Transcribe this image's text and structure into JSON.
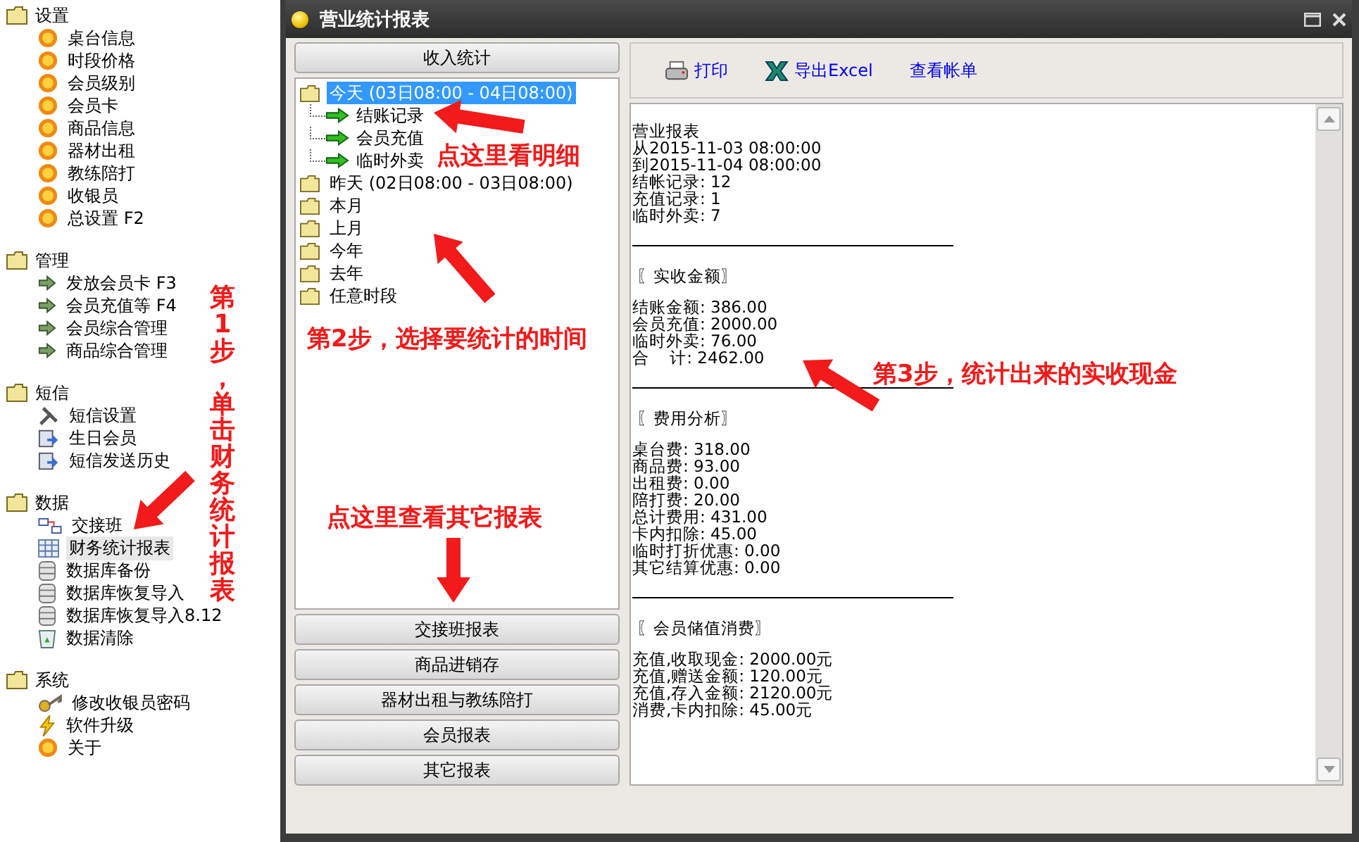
{
  "sidebar": {
    "groups": [
      {
        "label": "设置",
        "items": [
          {
            "label": "桌台信息",
            "kind": "sun",
            "selected": false
          },
          {
            "label": "时段价格",
            "kind": "sun",
            "selected": false
          },
          {
            "label": "会员级别",
            "kind": "sun",
            "selected": false
          },
          {
            "label": "会员卡",
            "kind": "sun",
            "selected": false
          },
          {
            "label": "商品信息",
            "kind": "sun",
            "selected": false
          },
          {
            "label": "器材出租",
            "kind": "sun",
            "selected": false
          },
          {
            "label": "教练陪打",
            "kind": "sun",
            "selected": false
          },
          {
            "label": "收银员",
            "kind": "sun",
            "selected": false
          },
          {
            "label": "总设置 F2",
            "kind": "sun",
            "selected": false
          }
        ]
      },
      {
        "label": "管理",
        "items": [
          {
            "label": "发放会员卡 F3",
            "kind": "arrow",
            "selected": false
          },
          {
            "label": "会员充值等 F4",
            "kind": "arrow",
            "selected": false
          },
          {
            "label": "会员综合管理",
            "kind": "arrow",
            "selected": false
          },
          {
            "label": "商品综合管理",
            "kind": "arrow",
            "selected": false
          }
        ]
      },
      {
        "label": "短信",
        "items": [
          {
            "label": "短信设置",
            "kind": "tools",
            "selected": false
          },
          {
            "label": "生日会员",
            "kind": "note",
            "selected": false
          },
          {
            "label": "短信发送历史",
            "kind": "note",
            "selected": false
          }
        ]
      },
      {
        "label": "数据",
        "items": [
          {
            "label": "交接班",
            "kind": "exchange",
            "selected": false
          },
          {
            "label": "财务统计报表",
            "kind": "table",
            "selected": true
          },
          {
            "label": "数据库备份",
            "kind": "database",
            "selected": false
          },
          {
            "label": "数据库恢复导入",
            "kind": "database",
            "selected": false
          },
          {
            "label": "数据库恢复导入8.12",
            "kind": "database",
            "selected": false
          },
          {
            "label": "数据清除",
            "kind": "bin",
            "selected": false
          }
        ]
      },
      {
        "label": "系统",
        "items": [
          {
            "label": "修改收银员密码",
            "kind": "key",
            "selected": false
          },
          {
            "label": "软件升级",
            "kind": "bolt",
            "selected": false
          },
          {
            "label": "关于",
            "kind": "sun",
            "selected": false
          }
        ]
      }
    ]
  },
  "window": {
    "title": "营业统计报表"
  },
  "period_panel": {
    "header_button": "收入统计",
    "tree": [
      {
        "label": "今天 (03日08:00 - 04日08:00)",
        "selected": true,
        "expanded": true,
        "children": [
          {
            "label": "结账记录",
            "selected": false
          },
          {
            "label": "会员充值",
            "selected": false
          },
          {
            "label": "临时外卖",
            "selected": false
          }
        ]
      },
      {
        "label": "昨天 (02日08:00 - 03日08:00)",
        "selected": false
      },
      {
        "label": "本月",
        "selected": false
      },
      {
        "label": "上月",
        "selected": false
      },
      {
        "label": "今年",
        "selected": false
      },
      {
        "label": "去年",
        "selected": false
      },
      {
        "label": "任意时段",
        "selected": false
      }
    ],
    "report_buttons": [
      "交接班报表",
      "商品进销存",
      "器材出租与教练陪打",
      "会员报表",
      "其它报表"
    ]
  },
  "toolbar": [
    {
      "label": "打印",
      "kind": "printer"
    },
    {
      "label": "导出Excel",
      "kind": "excel"
    },
    {
      "label": "查看帐单",
      "kind": "text"
    }
  ],
  "report": {
    "lines": [
      "营业报表",
      "从2015-11-03 08:00:00",
      "到2015-11-04 08:00:00",
      "结帐记录: 12",
      "充值记录: 1",
      "临时外卖: 7"
    ],
    "sections": [
      {
        "heading": "〖实收金额〗",
        "lines": [
          "结账金额: 386.00",
          "会员充值: 2000.00",
          "临时外卖: 76.00",
          "合    计: 2462.00"
        ]
      },
      {
        "heading": "〖费用分析〗",
        "lines": [
          "桌台费: 318.00",
          "商品费: 93.00",
          "出租费: 0.00",
          "陪打费: 20.00",
          "总计费用: 431.00",
          "卡内扣除: 45.00",
          "临时打折优惠: 0.00",
          "其它结算优惠: 0.00"
        ]
      },
      {
        "heading": "〖会员储值消费〗",
        "lines": [
          "充值,收取现金: 2000.00元",
          "充值,赠送金额: 120.00元",
          "充值,存入金额: 2120.00元",
          "消费,卡内扣除: 45.00元"
        ]
      }
    ]
  },
  "annotations": [
    {
      "text": "第1步，单击财务统计报表",
      "kind": "vertical"
    },
    {
      "text": "点这里看明细",
      "kind": "horizontal"
    },
    {
      "text": "第2步，选择要统计的时间",
      "kind": "horizontal"
    },
    {
      "text": "点这里查看其它报表",
      "kind": "horizontal"
    },
    {
      "text": "第3步，统计出来的实收现金",
      "kind": "horizontal"
    }
  ]
}
